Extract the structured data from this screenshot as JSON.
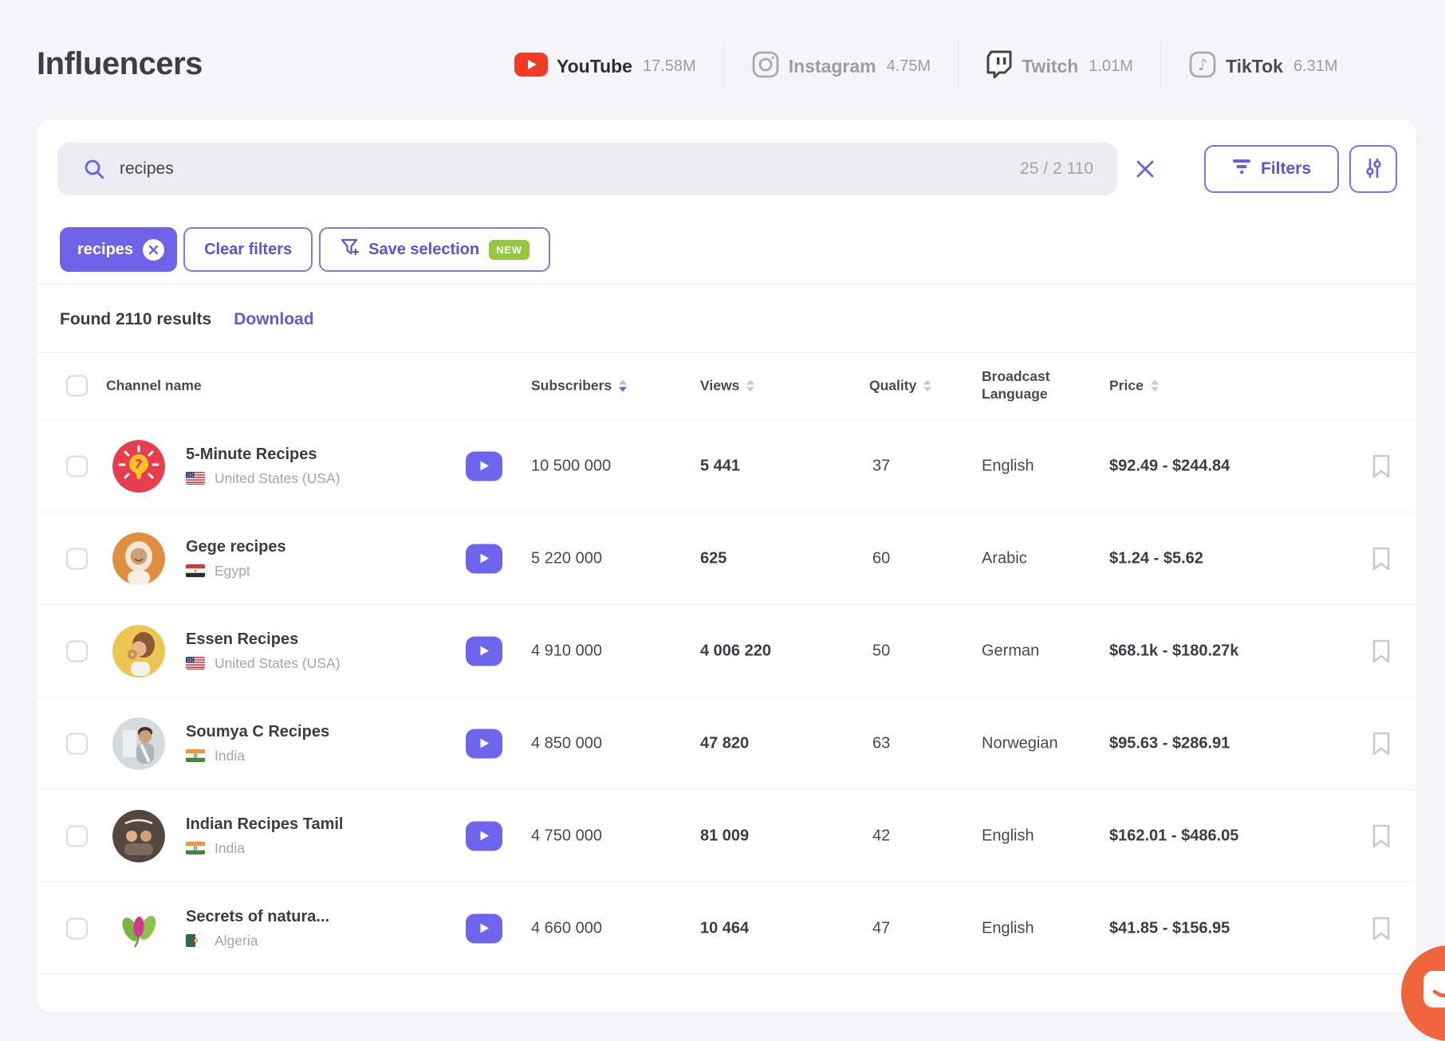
{
  "page_title": "Influencers",
  "platform_tabs": [
    {
      "name": "YouTube",
      "count": "17.58M",
      "icon": "youtube-icon",
      "active": true
    },
    {
      "name": "Instagram",
      "count": "4.75M",
      "icon": "instagram-icon",
      "active": false
    },
    {
      "name": "Twitch",
      "count": "1.01M",
      "icon": "twitch-icon",
      "active": false
    },
    {
      "name": "TikTok",
      "count": "6.31M",
      "icon": "tiktok-icon",
      "active": false
    }
  ],
  "search": {
    "query": "recipes",
    "counter": "25 / 2 110",
    "filters_label": "Filters"
  },
  "filter_bar": {
    "chip": "recipes",
    "clear_label": "Clear filters",
    "save_label": "Save selection",
    "save_badge": "NEW"
  },
  "results": {
    "summary": "Found 2110 results",
    "download_label": "Download"
  },
  "table": {
    "columns": {
      "channel": "Channel name",
      "subscribers": "Subscribers",
      "views": "Views",
      "quality": "Quality",
      "language": "Broadcast Language",
      "price": "Price"
    },
    "sorted_by": "subscribers",
    "rows": [
      {
        "name": "5-Minute Recipes",
        "country": "United States (USA)",
        "flag": "flag-usa",
        "avatar": "five-minute-recipes-logo",
        "subscribers": "10 500 000",
        "views": "5 441",
        "quality": "37",
        "language": "English",
        "price": "$92.49 - $244.84"
      },
      {
        "name": "Gege recipes",
        "country": "Egypt",
        "flag": "flag-egypt",
        "avatar": "gege-recipes-portrait",
        "subscribers": "5 220 000",
        "views": "625",
        "quality": "60",
        "language": "Arabic",
        "price": "$1.24 - $5.62"
      },
      {
        "name": "Essen Recipes",
        "country": "United States (USA)",
        "flag": "flag-usa",
        "avatar": "essen-recipes-portrait",
        "subscribers": "4 910 000",
        "views": "4 006 220",
        "quality": "50",
        "language": "German",
        "price": "$68.1k - $180.27k"
      },
      {
        "name": "Soumya C Recipes",
        "country": "India",
        "flag": "flag-india",
        "avatar": "soumya-recipes-portrait",
        "subscribers": "4 850 000",
        "views": "47 820",
        "quality": "63",
        "language": "Norwegian",
        "price": "$95.63 - $286.91"
      },
      {
        "name": "Indian Recipes Tamil",
        "country": "India",
        "flag": "flag-india",
        "avatar": "indian-recipes-tamil-logo",
        "subscribers": "4 750 000",
        "views": "81 009",
        "quality": "42",
        "language": "English",
        "price": "$162.01 - $486.05"
      },
      {
        "name": "Secrets of natura...",
        "country": "Algeria",
        "flag": "flag-algeria",
        "avatar": "secrets-of-nature-logo",
        "subscribers": "4 660 000",
        "views": "10 464",
        "quality": "47",
        "language": "English",
        "price": "$41.85 - $156.95"
      }
    ]
  },
  "colors": {
    "accent_purple": "#6b5fe8",
    "youtube_red": "#f23b25",
    "badge_green": "#96c83d",
    "chat_orange": "#f0653e"
  }
}
